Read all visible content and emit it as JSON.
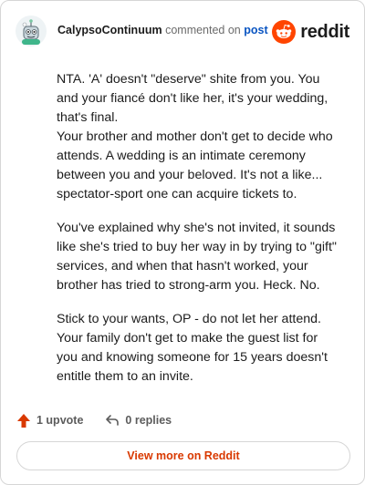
{
  "header": {
    "username": "CalypsoContinuum",
    "action_text": "commented on",
    "post_link": "post",
    "logo_text": "reddit",
    "logo_icon": "reddit-snoo-icon",
    "avatar_icon": "robot-avatar-icon"
  },
  "comment": {
    "paragraphs": [
      "NTA. 'A' doesn't \"deserve\" shite from you. You and your fiancé don't like her, it's your wedding, that's final.\nYour brother and mother don't get to decide who attends. A wedding is an intimate ceremony between you and your beloved. It's not a like... spectator-sport one can acquire tickets to.",
      "You've explained why she's not invited, it sounds like she's tried to buy her way in by trying to \"gift\" services, and when that hasn't worked, your brother has tried to strong-arm you. Heck. No.",
      "Stick to your wants, OP - do not let her attend. Your family don't get to make the guest list for you and knowing someone for 15 years doesn't entitle them to an invite."
    ]
  },
  "actions": {
    "upvote_label": "1 upvote",
    "replies_label": "0 replies",
    "upvote_icon": "upvote-arrow-icon",
    "reply_icon": "reply-arrow-icon"
  },
  "footer": {
    "view_more_label": "View more on Reddit"
  },
  "colors": {
    "accent": "#d93900",
    "brand": "#ff4500",
    "link": "#0a55c2"
  }
}
